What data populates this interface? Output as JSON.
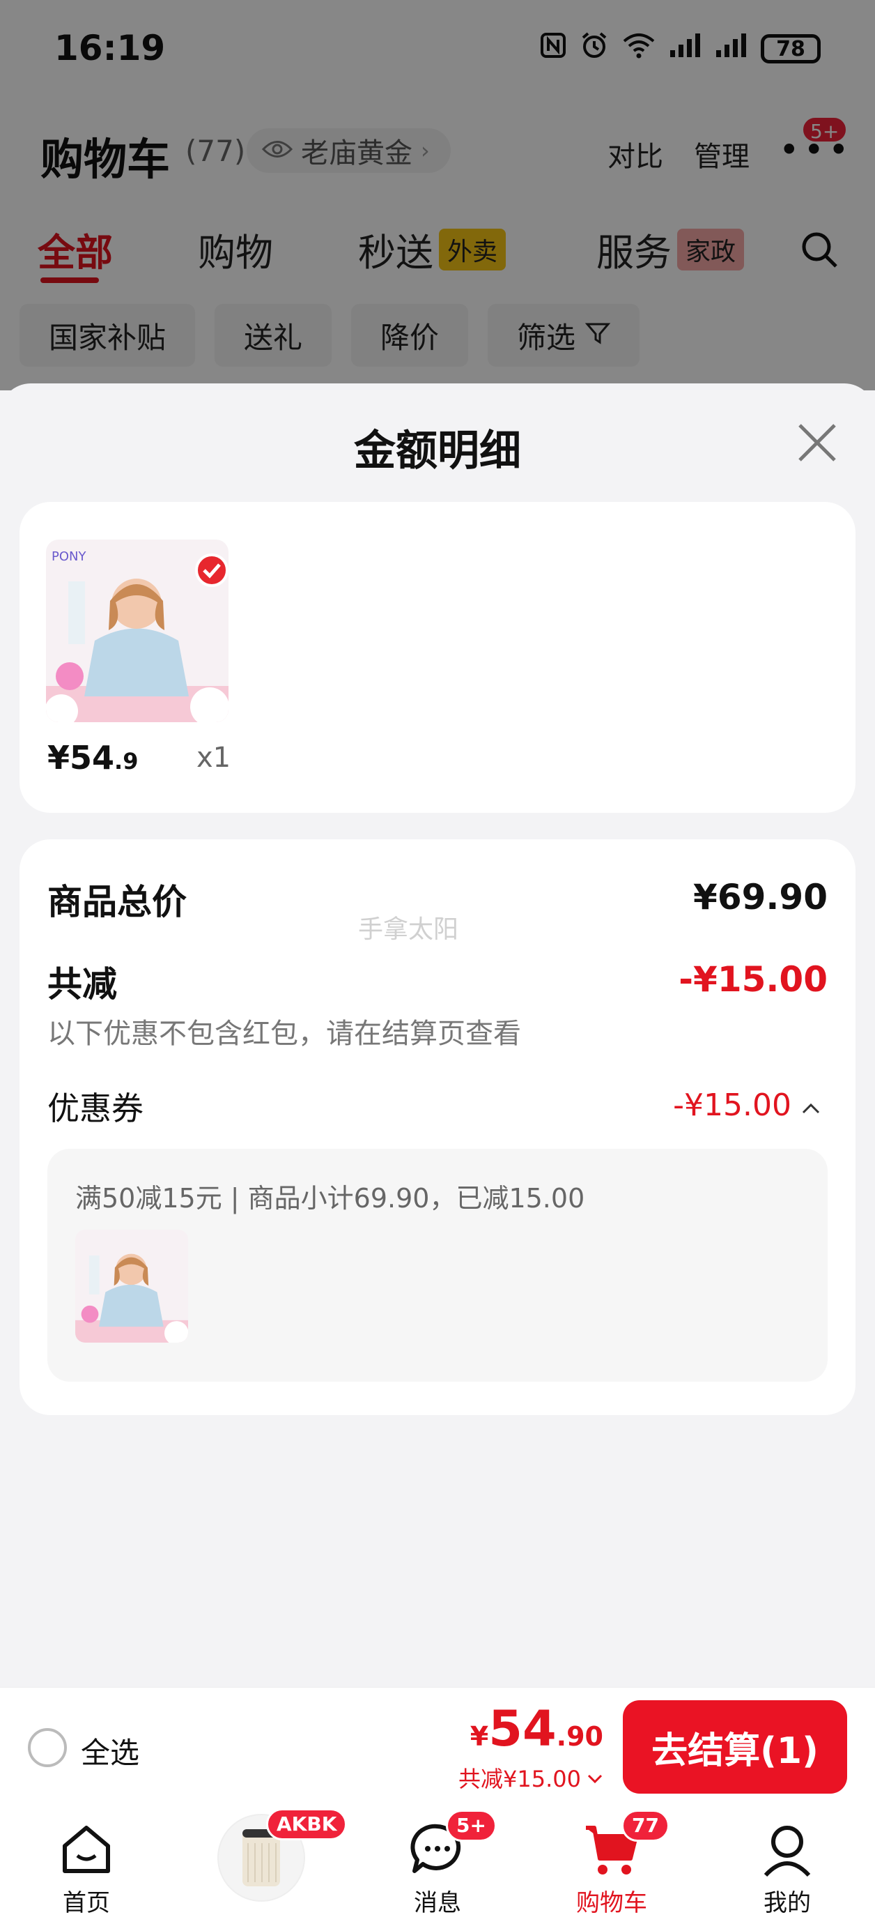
{
  "status_bar": {
    "time": "16:19",
    "battery": "78"
  },
  "header": {
    "title": "购物车",
    "count": "(77)",
    "store_pill": "老庙黄金",
    "compare": "对比",
    "manage": "管理",
    "more_badge": "5+"
  },
  "tabs": [
    {
      "label": "全部"
    },
    {
      "label": "购物"
    },
    {
      "label": "秒送",
      "tag": "外卖"
    },
    {
      "label": "服务",
      "tag": "家政"
    }
  ],
  "filters": [
    "国家补贴",
    "送礼",
    "降价",
    "筛选"
  ],
  "sheet": {
    "title": "金额明细",
    "product": {
      "price_int": "¥54",
      "price_dec": ".9",
      "qty": "x1"
    },
    "watermark": "手拿太阳",
    "summary": {
      "goods_total_label": "商品总价",
      "goods_total_value": "¥69.90",
      "discount_label": "共减",
      "discount_value": "-¥15.00",
      "discount_note": "以下优惠不包含红包，请在结算页查看",
      "coupon_label": "优惠券",
      "coupon_value": "-¥15.00",
      "coupon_desc": "满50减15元 | 商品小计69.90，已减15.00"
    }
  },
  "checkout": {
    "select_all": "全选",
    "price_symbol": "¥",
    "price_int": "54",
    "price_dec": ".90",
    "discount": "共减¥15.00",
    "button": "去结算(1)"
  },
  "bottom_nav": {
    "home": "首页",
    "promo_badge": "AKBK",
    "messages": "消息",
    "messages_badge": "5+",
    "cart": "购物车",
    "cart_badge": "77",
    "mine": "我的"
  },
  "colors": {
    "accent": "#e1141f",
    "button": "#ea1324",
    "tag_yellow": "#f6c515",
    "tag_pink": "#f6a9a6"
  }
}
